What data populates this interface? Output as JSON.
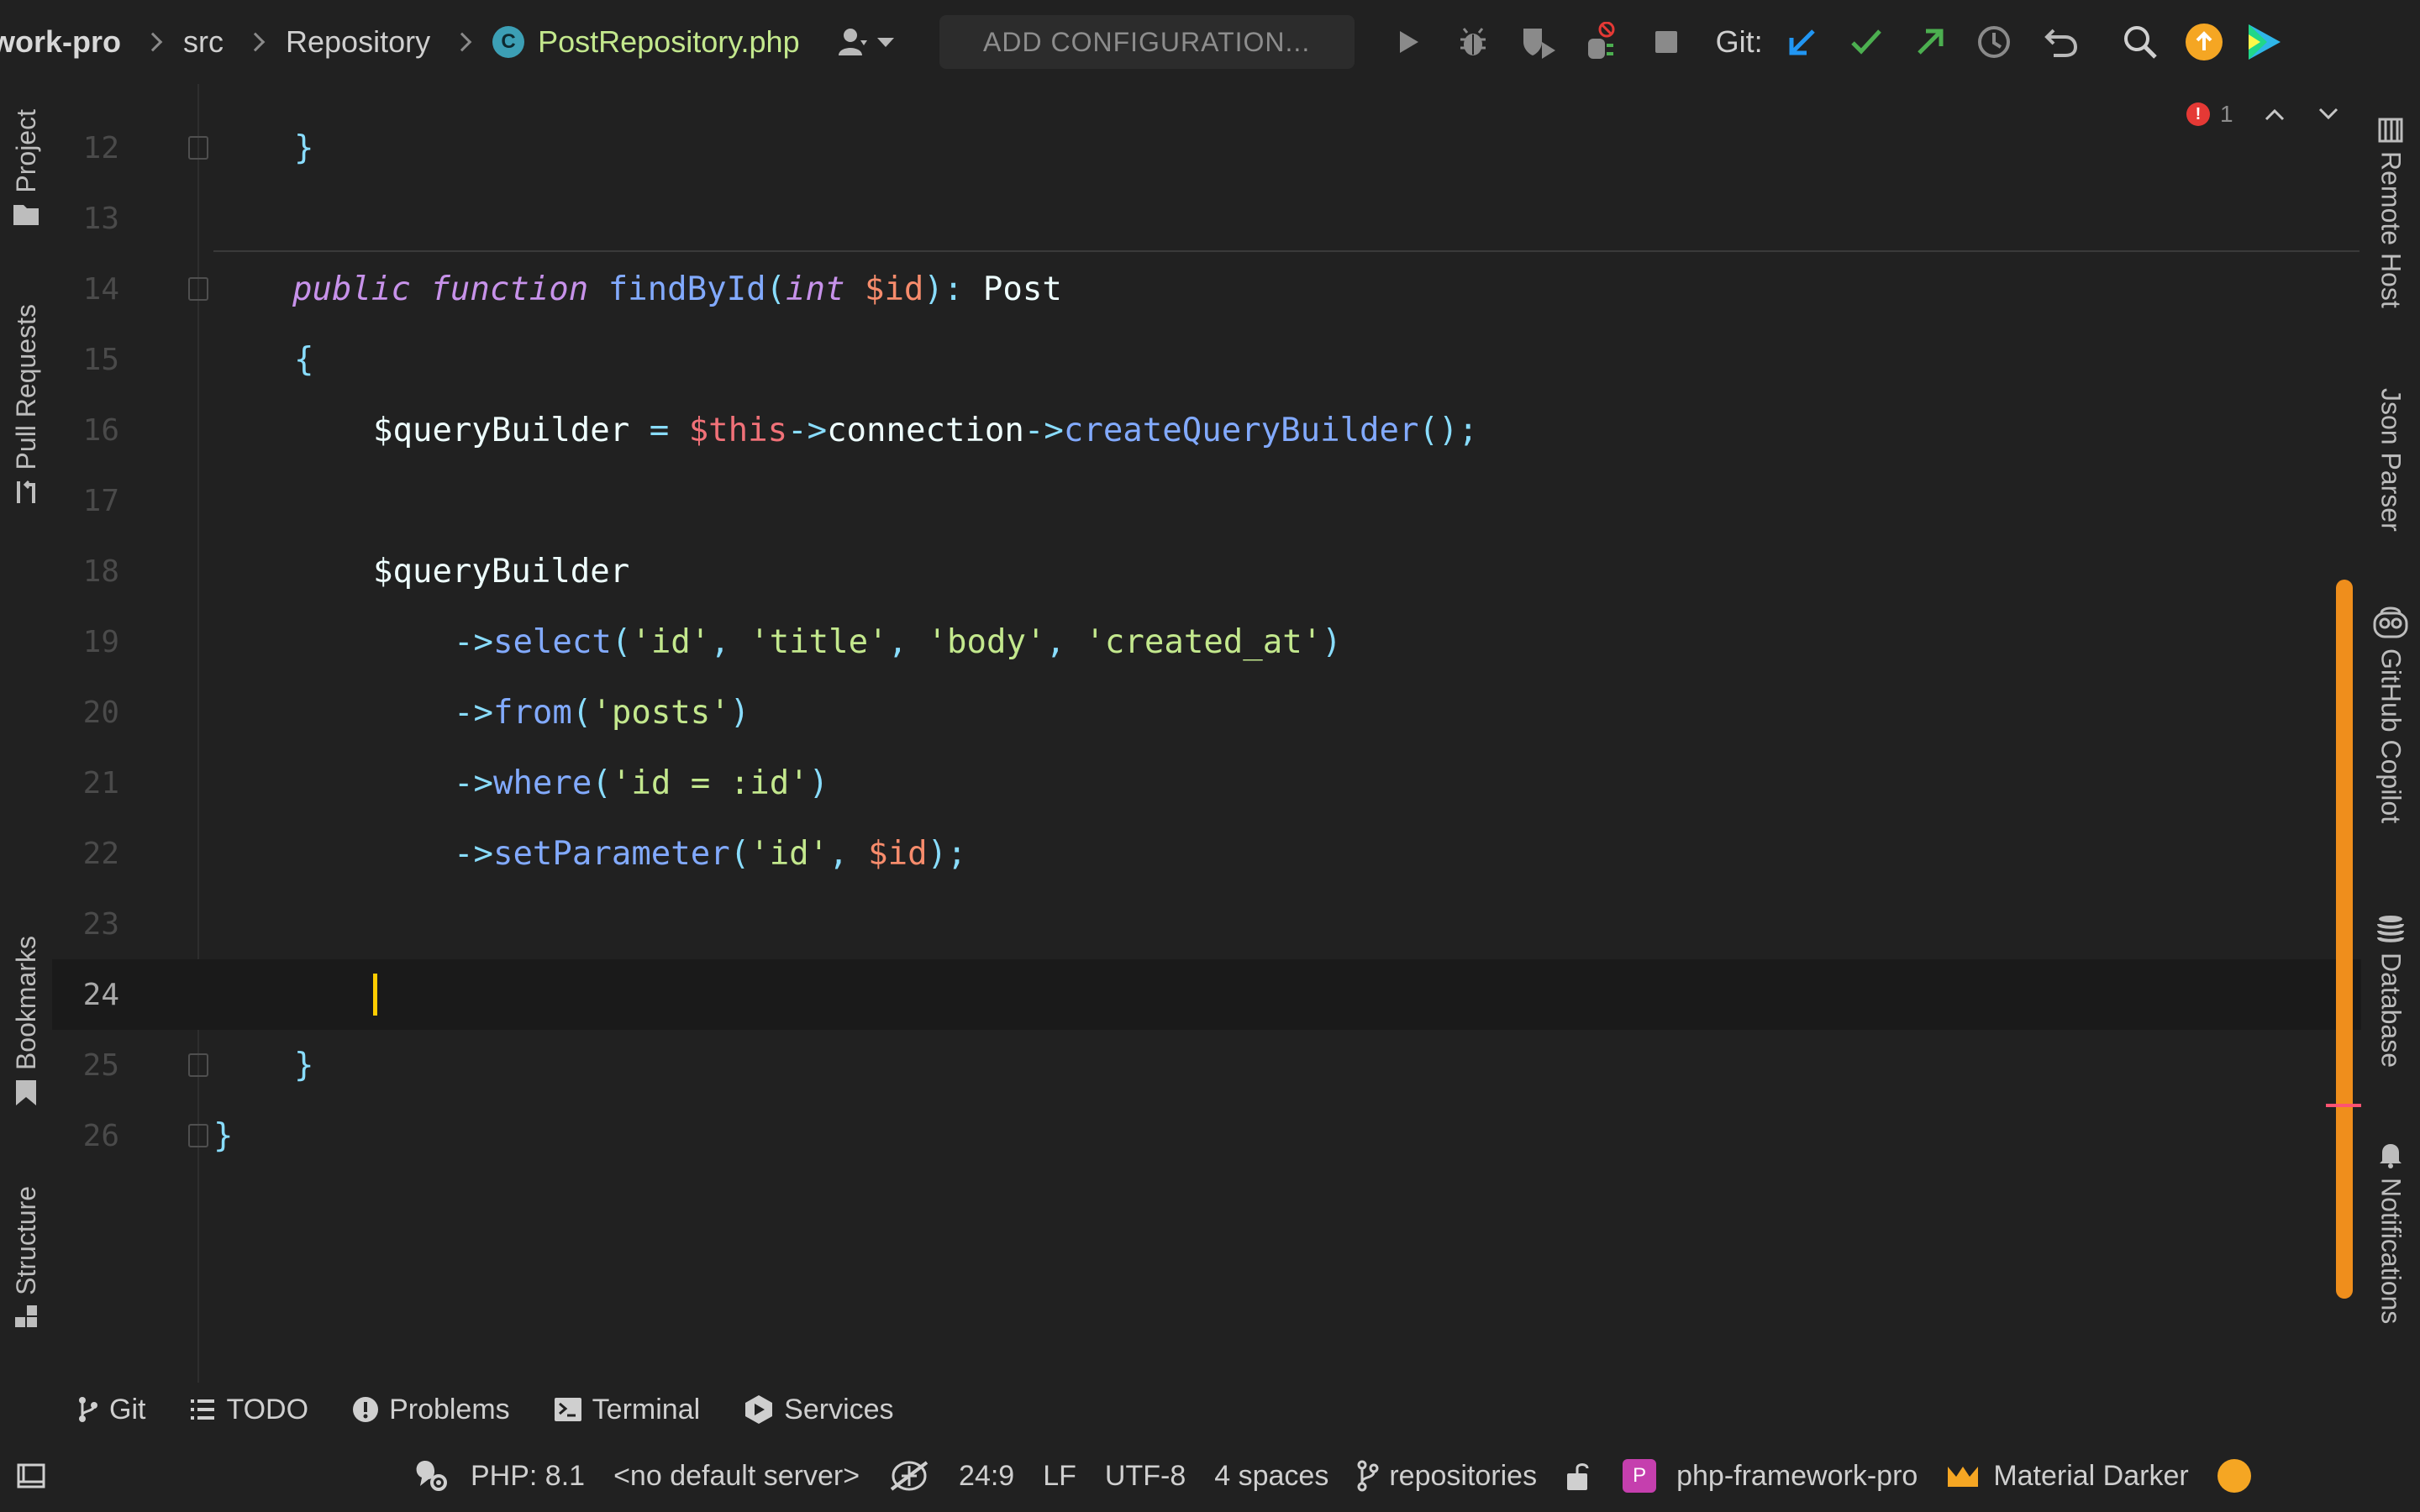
{
  "breadcrumb": {
    "project": "work-pro",
    "folder1": "src",
    "folder2": "Repository",
    "file": "PostRepository.php",
    "file_badge": "C"
  },
  "toolbar": {
    "add_configuration": "ADD CONFIGURATION...",
    "git_label": "Git:",
    "icons": [
      "user-icon",
      "run-icon",
      "debug-icon",
      "coverage-icon",
      "profile-icon",
      "stop-icon",
      "git-update-icon",
      "git-commit-icon",
      "git-push-icon",
      "history-icon",
      "rollback-icon",
      "search-icon",
      "ide-update-icon",
      "jetbrains-logo-icon"
    ]
  },
  "left_tabs": {
    "project": "Project",
    "pull_requests": "Pull Requests",
    "bookmarks": "Bookmarks",
    "structure": "Structure"
  },
  "right_tabs": {
    "remote_host": "Remote Host",
    "json_parser": "Json Parser",
    "github_copilot": "GitHub Copilot",
    "database": "Database",
    "notifications": "Notifications"
  },
  "editor": {
    "error_count": "1",
    "current_line": "24",
    "lines": [
      {
        "n": "12"
      },
      {
        "n": "13"
      },
      {
        "n": "14"
      },
      {
        "n": "15"
      },
      {
        "n": "16"
      },
      {
        "n": "17"
      },
      {
        "n": "18"
      },
      {
        "n": "19"
      },
      {
        "n": "20"
      },
      {
        "n": "21"
      },
      {
        "n": "22"
      },
      {
        "n": "23"
      },
      {
        "n": "24"
      },
      {
        "n": "25"
      },
      {
        "n": "26"
      }
    ],
    "tokens": {
      "brace_close": "}",
      "brace_open": "{",
      "kw_public": "public",
      "kw_function": "function",
      "fn_find": "findById",
      "paren_open": "(",
      "type_int": "int",
      "param_id": "$id",
      "return_sep": "): ",
      "return_type": "Post",
      "var_qb": "$queryBuilder",
      "assign": " = ",
      "this": "$this",
      "arrow": "->",
      "prop_connection": "connection",
      "fn_create": "createQueryBuilder",
      "call_end": "();",
      "fn_select": "select",
      "str_id": "'id'",
      "comma": ", ",
      "str_title": "'title'",
      "str_body": "'body'",
      "str_created": "'created_at'",
      "paren_close": ")",
      "fn_from": "from",
      "str_posts": "'posts'",
      "fn_where": "where",
      "str_where": "'id = :id'",
      "fn_setparam": "setParameter",
      "stmt_end": ");"
    }
  },
  "bottom_tabs": {
    "git": "Git",
    "todo": "TODO",
    "problems": "Problems",
    "terminal": "Terminal",
    "services": "Services"
  },
  "status": {
    "php": "PHP: 8.1",
    "server": "<no default server>",
    "position": "24:9",
    "line_sep": "LF",
    "encoding": "UTF-8",
    "indent": "4 spaces",
    "branch": "repositories",
    "project_badge": "P",
    "project": "php-framework-pro",
    "theme": "Material Darker"
  }
}
